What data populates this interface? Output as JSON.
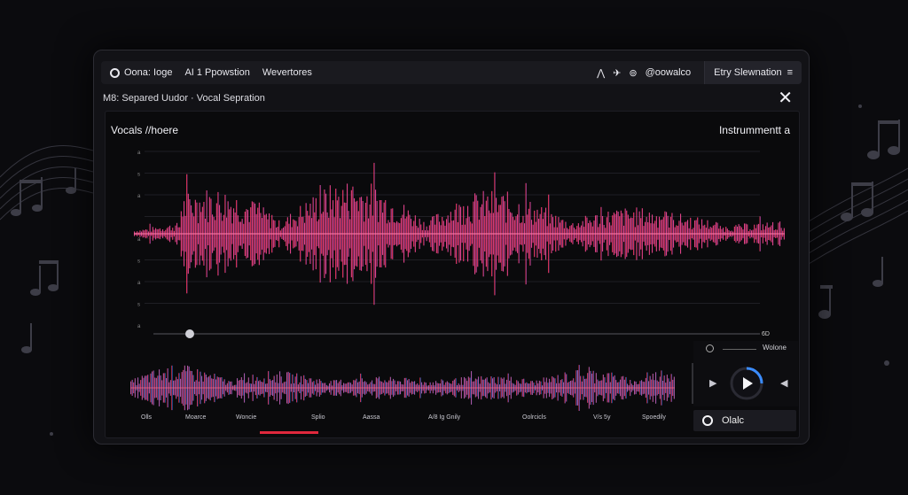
{
  "topbar": {
    "nav": [
      "Oona: Ioge",
      "AI 1 Ppowstion",
      "Wevertores"
    ],
    "icons": [
      "a-icon",
      "bird-icon",
      "at-icon"
    ],
    "handle": "@oowalco",
    "entry_label": "Etry Slewnation",
    "menu_icon": "≡"
  },
  "subbar": {
    "title": "M8: Separed Uudor · Vocal Seprati​on",
    "close_icon": "✕"
  },
  "panel": {
    "left_label": "Vocals //hoere",
    "right_label": "Instrummentt a",
    "y_ticks": [
      "a",
      "s",
      "a",
      "",
      "a",
      "s",
      "a",
      "s",
      "a"
    ],
    "end_label": "6D",
    "bottom_labels": [
      "Olls",
      "Moarce",
      "Woncie",
      "Splio",
      "Aassa",
      "A/8 Ig Gnily",
      "Oolrcicls",
      "V/s 5y",
      "Spoedily"
    ]
  },
  "controls": {
    "top_label": "Wolone",
    "bottom_label": "Olalc",
    "prev_icon": "▶",
    "next_icon": "◀",
    "play_icon": "▶"
  },
  "colors": {
    "vocals": "#ff3b5c",
    "mix": "#b446b8",
    "instrument": "#2e7ff5",
    "accent": "#e0283c"
  }
}
